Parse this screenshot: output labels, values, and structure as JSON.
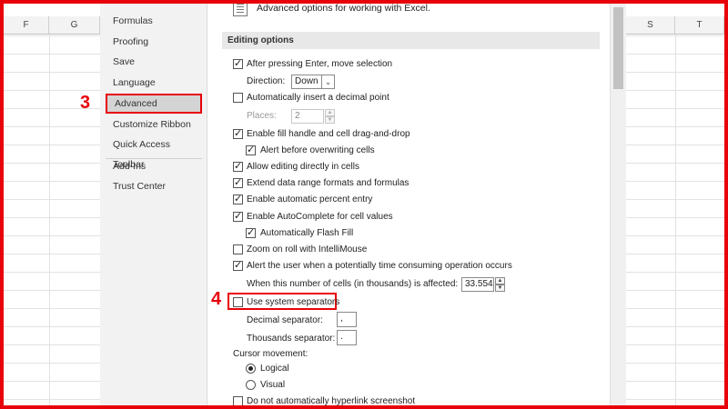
{
  "sheet": {
    "left_columns": [
      "F",
      "G"
    ],
    "right_columns": [
      "S",
      "T"
    ]
  },
  "sidebar": {
    "items": [
      {
        "label": "Formulas"
      },
      {
        "label": "Proofing"
      },
      {
        "label": "Save"
      },
      {
        "label": "Language"
      },
      {
        "label": "Advanced"
      },
      {
        "label": "Customize Ribbon"
      },
      {
        "label": "Quick Access Toolbar"
      },
      {
        "label": "Add-Ins"
      },
      {
        "label": "Trust Center"
      }
    ],
    "active": "Advanced"
  },
  "header": {
    "text": "Advanced options for working with Excel."
  },
  "section": {
    "title": "Editing options"
  },
  "options": {
    "after_enter": {
      "label": "After pressing Enter, move selection",
      "checked": true
    },
    "direction": {
      "label": "Direction:",
      "value": "Down"
    },
    "auto_decimal": {
      "label": "Automatically insert a decimal point",
      "checked": false
    },
    "places": {
      "label": "Places:",
      "value": "2"
    },
    "fill_handle": {
      "label": "Enable fill handle and cell drag-and-drop",
      "checked": true
    },
    "alert_overwrite": {
      "label": "Alert before overwriting cells",
      "checked": true
    },
    "edit_in_cells": {
      "label": "Allow editing directly in cells",
      "checked": true
    },
    "extend_formats": {
      "label": "Extend data range formats and formulas",
      "checked": true
    },
    "auto_percent": {
      "label": "Enable automatic percent entry",
      "checked": true
    },
    "autocomplete": {
      "label": "Enable AutoComplete for cell values",
      "checked": true
    },
    "flash_fill": {
      "label": "Automatically Flash Fill",
      "checked": true
    },
    "zoom_roll": {
      "label": "Zoom on roll with IntelliMouse",
      "checked": false
    },
    "alert_slow": {
      "label": "Alert the user when a potentially time consuming operation occurs",
      "checked": true
    },
    "cells_affected": {
      "label": "When this number of cells (in thousands) is affected:",
      "value": "33.554"
    },
    "system_separators": {
      "label": "Use system separators",
      "checked": false
    },
    "decimal_sep": {
      "label": "Decimal separator:",
      "value": ","
    },
    "thousands_sep": {
      "label": "Thousands separator:",
      "value": "."
    },
    "cursor_movement": {
      "label": "Cursor movement:"
    },
    "cursor_logical": {
      "label": "Logical",
      "selected": true
    },
    "cursor_visual": {
      "label": "Visual",
      "selected": false
    },
    "no_hyperlink": {
      "label": "Do not automatically hyperlink screenshot",
      "checked": false
    }
  },
  "annotations": {
    "step3": "3",
    "step4": "4"
  },
  "colors": {
    "highlight": "#e8000b",
    "sidebar_bg": "#f2f2f2",
    "section_bg": "#e8e8e8"
  }
}
